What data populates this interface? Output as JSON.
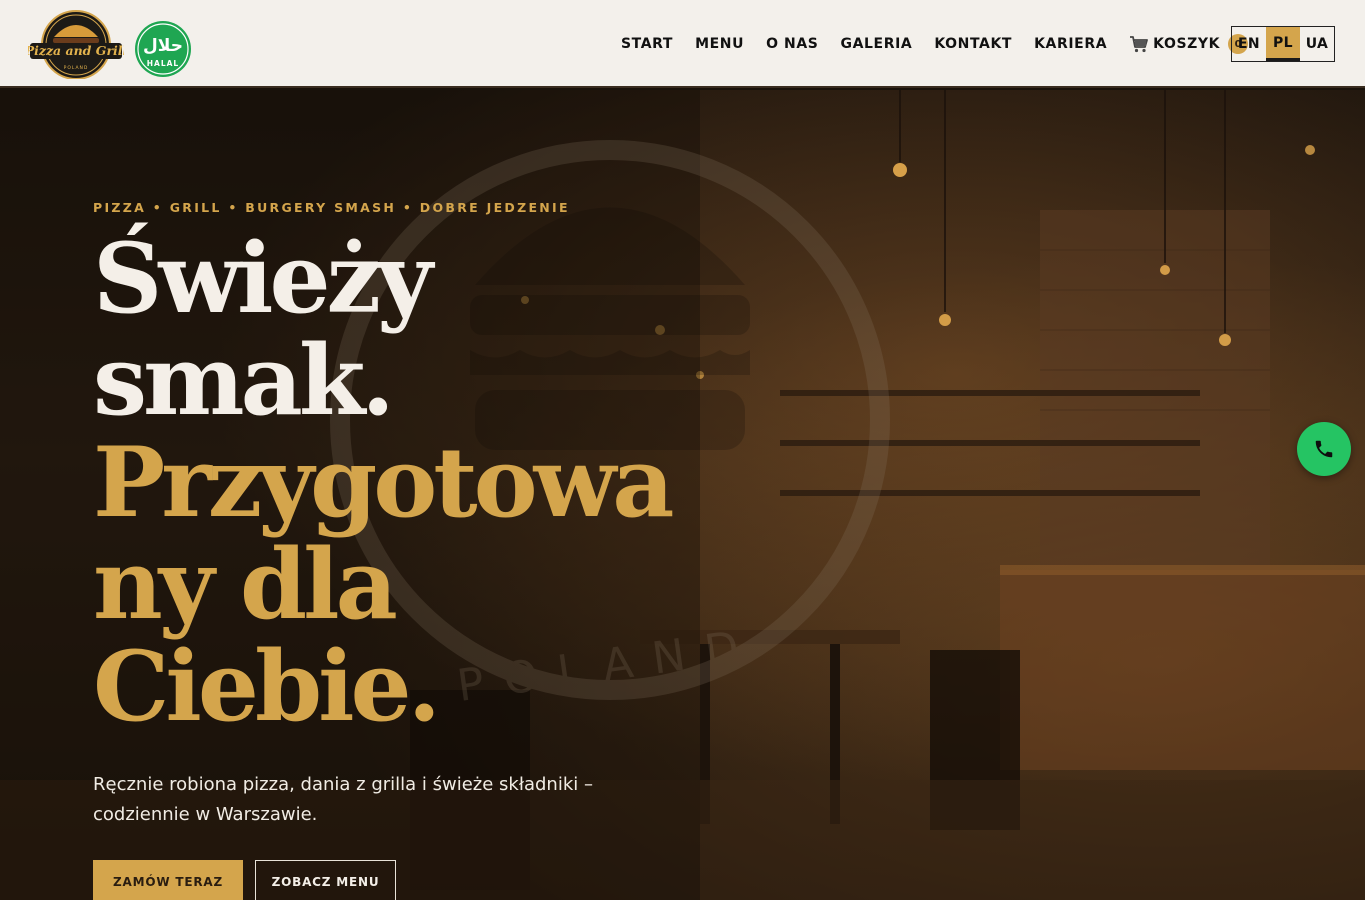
{
  "header": {
    "logo_text": "Pizza and Grill",
    "logo_subtext": "POLAND",
    "halal_text": "HALAL",
    "halal_arabic": "حلال",
    "nav": [
      {
        "label": "START"
      },
      {
        "label": "MENU"
      },
      {
        "label": "O NAS"
      },
      {
        "label": "GALERIA"
      },
      {
        "label": "KONTAKT"
      },
      {
        "label": "KARIERA"
      }
    ],
    "cart": {
      "label": "KOSZYK",
      "count": "0",
      "icon": "cart-icon"
    },
    "languages": [
      {
        "code": "EN",
        "active": false
      },
      {
        "code": "PL",
        "active": true
      },
      {
        "code": "UA",
        "active": false
      }
    ]
  },
  "hero": {
    "tagline": "PIZZA • GRILL • BURGERY SMASH • DOBRE JEDZENIE",
    "headline_line1": "Świeży",
    "headline_line2": "smak.",
    "headline_line3": "Przygotowa",
    "headline_line4": "ny dla",
    "headline_line5": "Ciebie.",
    "subtext": "Ręcznie robiona pizza, dania z grilla i świeże składniki – codziennie w Warszawie.",
    "primary_button": "ZAMÓW TERAZ",
    "secondary_button": "ZOBACZ MENU",
    "phone_icon": "phone-icon",
    "watermark_text": "POLAND"
  },
  "colors": {
    "accent": "#d4a54c",
    "header_bg": "#f3f0eb",
    "phone_green": "#25c463",
    "text_light": "#f4efe8"
  }
}
